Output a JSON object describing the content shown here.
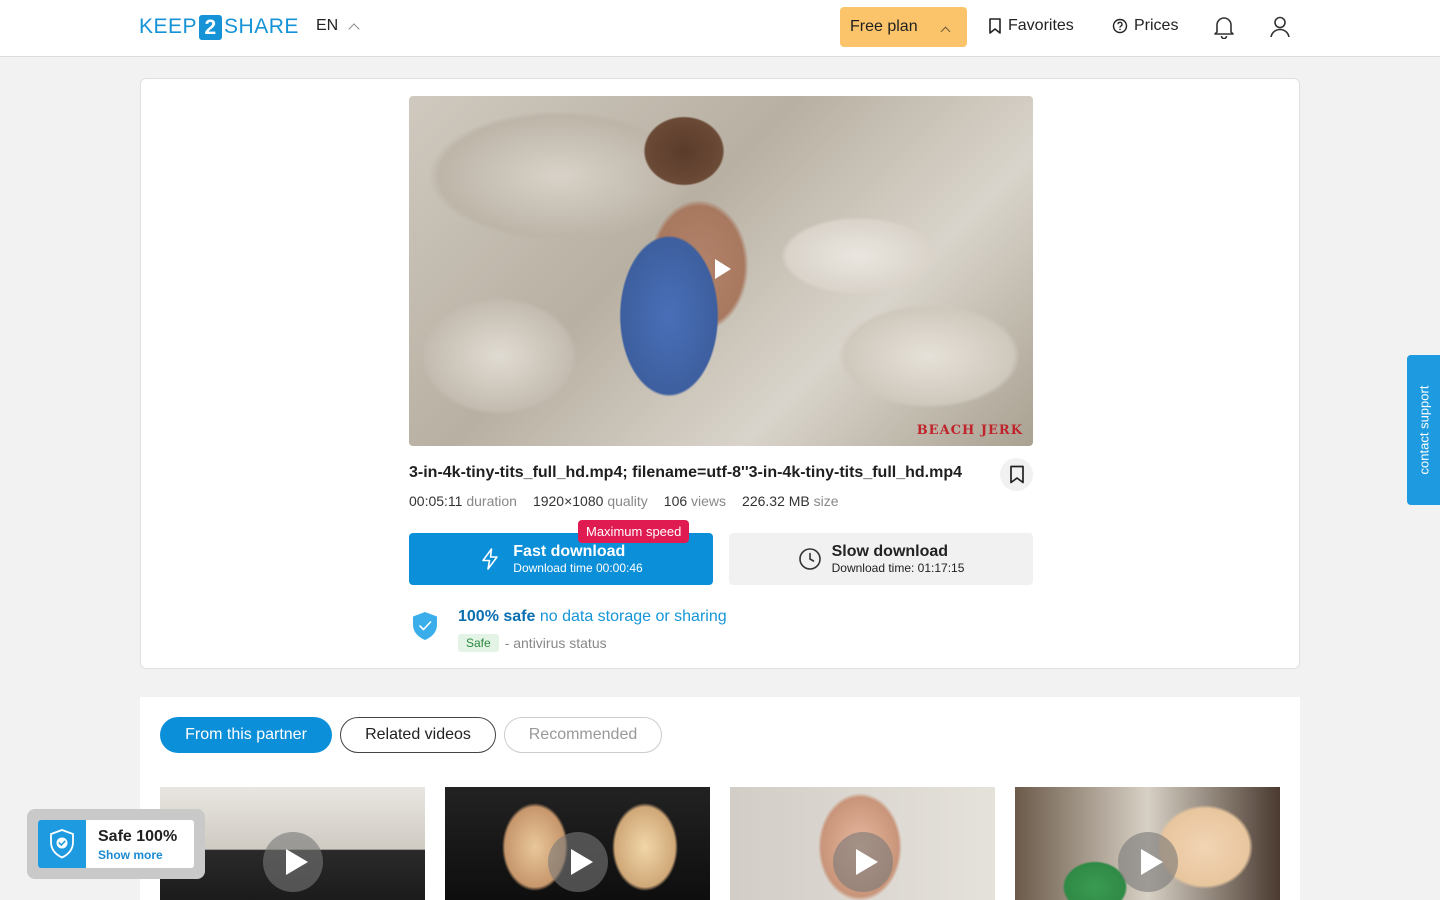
{
  "header": {
    "logo_left": "KEEP",
    "logo_mid": "2",
    "logo_right": "SHARE",
    "lang": "EN",
    "plan_label": "Free plan",
    "favorites_label": "Favorites",
    "prices_label": "Prices"
  },
  "file": {
    "title": "3-in-4k-tiny-tits_full_hd.mp4; filename=utf-8''3-in-4k-tiny-tits_full_hd.mp4",
    "duration": "00:05:11",
    "duration_label": "duration",
    "quality": "1920×1080",
    "quality_label": "quality",
    "views": "106",
    "views_label": "views",
    "size": "226.32 MB",
    "size_label": "size",
    "watermark": "BEACH JERK"
  },
  "download": {
    "fast_label": "Fast download",
    "fast_time": "Download time 00:00:46",
    "badge": "Maximum speed",
    "slow_label": "Slow download",
    "slow_time": "Download time: 01:17:15"
  },
  "safety": {
    "strong": "100% safe",
    "text": "no data storage or sharing",
    "tag": "Safe",
    "status": "- antivirus status"
  },
  "support": {
    "label": "contact support"
  },
  "tabs": [
    "From this partner",
    "Related videos",
    "Recommended"
  ],
  "widget": {
    "title": "Safe 100%",
    "link": "Show more"
  },
  "colors": {
    "accent": "#0b8fd8",
    "plan": "#fbc46a",
    "badge": "#e01b52"
  }
}
